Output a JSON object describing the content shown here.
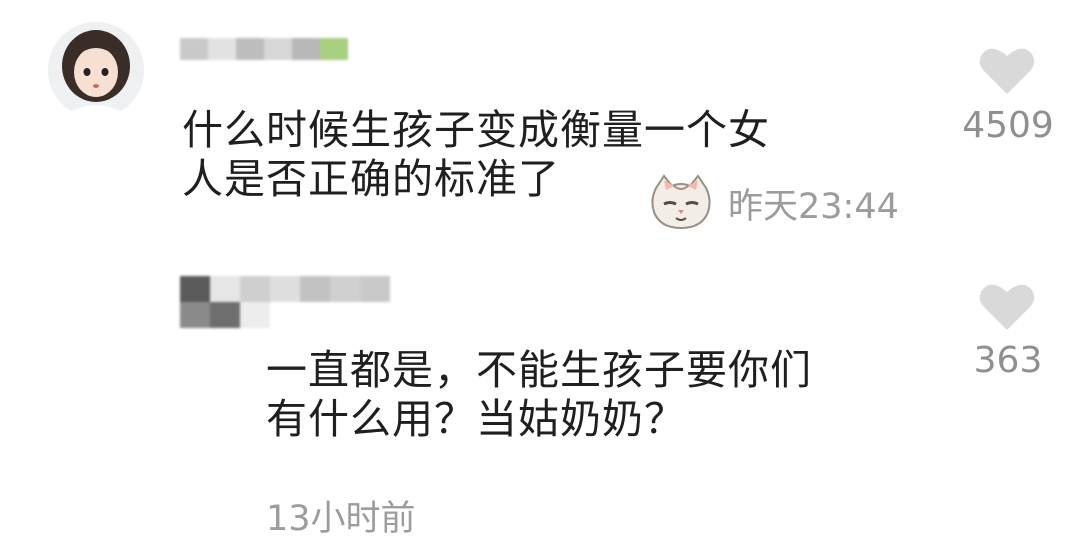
{
  "comments": [
    {
      "text_lines": [
        "什么时候生孩子变成衡量一个女",
        "人是否正确的标准了"
      ],
      "emoji": "cat-face-emoji",
      "time": "昨天23:44",
      "likes": "4509"
    },
    {
      "text_lines": [
        "一直都是，不能生孩子要你们",
        "有什么用？当姑奶奶？"
      ],
      "time": "13小时前",
      "likes": "363"
    }
  ],
  "icons": {
    "like": "heart-icon",
    "avatar": "avatar"
  },
  "colors": {
    "text": "#1f1f1f",
    "meta": "#9c9c9c",
    "heart": "#d9d9d9",
    "mosaic_accent": "#8bc34a"
  }
}
